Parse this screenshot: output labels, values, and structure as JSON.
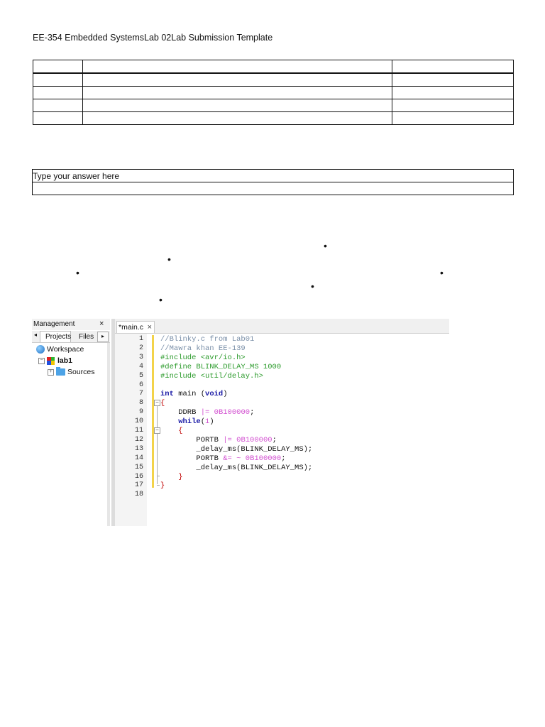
{
  "document": {
    "title": "EE-354 Embedded SystemsLab 02Lab Submission Template"
  },
  "answer_box": {
    "placeholder": "Type your answer here"
  },
  "ide": {
    "management": {
      "title": "Management",
      "close": "×",
      "tab_left_arrow": "◂",
      "tab_projects": "Projects",
      "tab_files": "Files",
      "tab_right_arrow": "▸",
      "tree": {
        "workspace": "Workspace",
        "project": "lab1",
        "sources": "Sources"
      }
    },
    "editor": {
      "tab_label": "*main.c",
      "tab_close": "×",
      "line_numbers": [
        "1",
        "2",
        "3",
        "4",
        "5",
        "6",
        "7",
        "8",
        "9",
        "10",
        "11",
        "12",
        "13",
        "14",
        "15",
        "16",
        "17",
        "18"
      ],
      "lines": [
        "//Blinky.c from Lab01",
        "//Mawra khan EE-139",
        "#include <avr/io.h>",
        "#define BLINK_DELAY_MS 1000",
        "#include <util/delay.h>",
        "",
        "int main (void)",
        "{",
        "    DDRB |= 0B100000;",
        "    while(1)",
        "    {",
        "        PORTB |= 0B100000;",
        "        _delay_ms(BLINK_DELAY_MS);",
        "        PORTB &= ~ 0B100000;",
        "        _delay_ms(BLINK_DELAY_MS);",
        "    }",
        "}",
        ""
      ]
    }
  }
}
